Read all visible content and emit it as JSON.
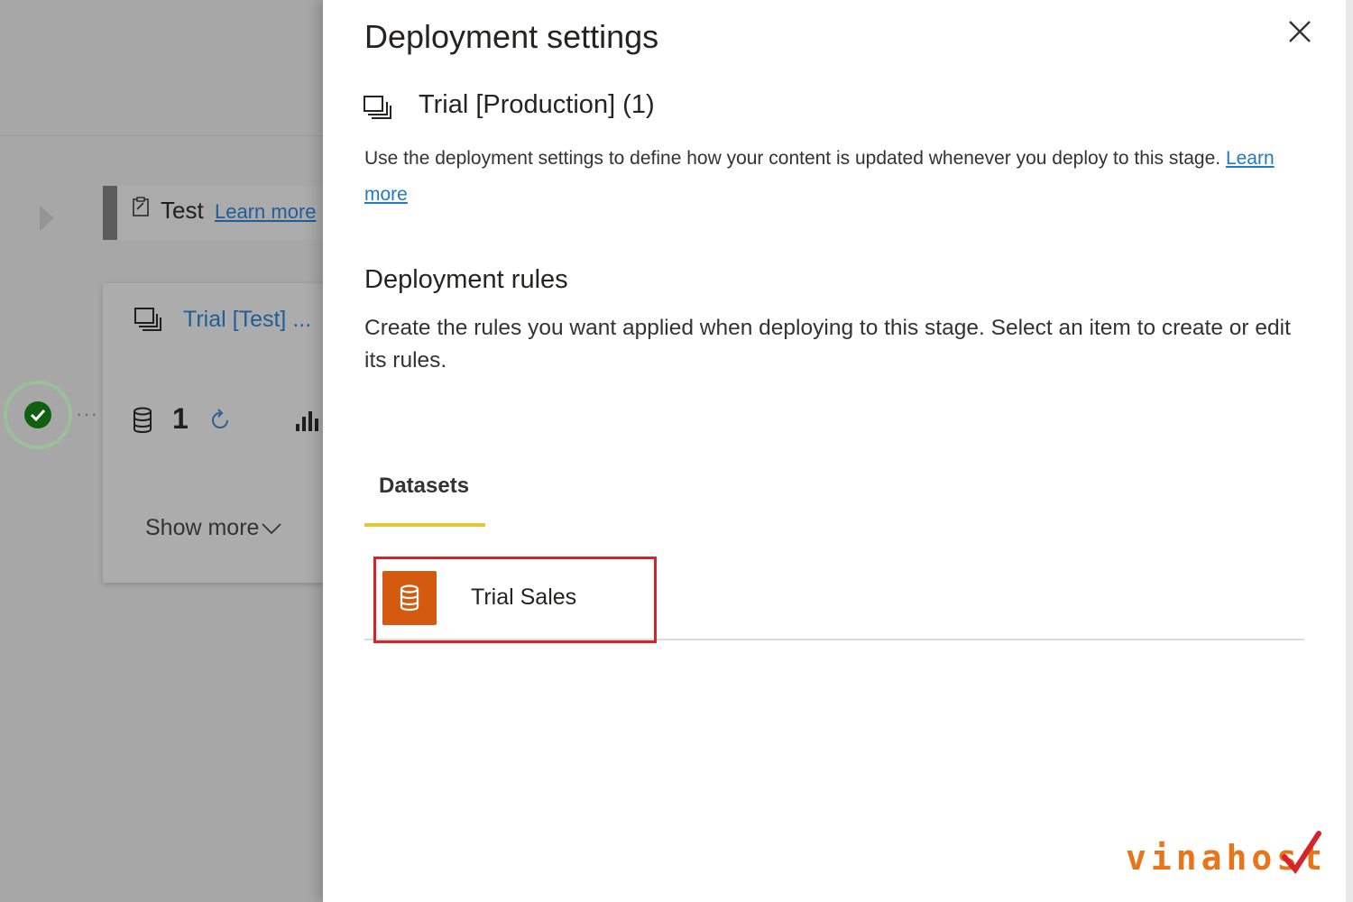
{
  "background": {
    "stage": {
      "name": "Test",
      "link": "Learn more"
    },
    "workspace_card": {
      "name": "Trial [Test] ...",
      "dataset_count": "1",
      "show_more": "Show more"
    },
    "status": "success"
  },
  "panel": {
    "title": "Deployment settings",
    "workspace": "Trial [Production] (1)",
    "description": "Use the deployment settings to define how your content is updated whenever you deploy to this stage.",
    "description_link": "Learn more",
    "rules_title": "Deployment rules",
    "rules_description": "Create the rules you want applied when deploying to this stage. Select an item to create or edit its rules.",
    "tabs": [
      {
        "label": "Datasets",
        "active": true
      }
    ],
    "datasets": [
      {
        "name": "Trial Sales",
        "icon": "dataset-icon",
        "highlighted": true
      }
    ]
  },
  "colors": {
    "accent_tab": "#e8c53a",
    "dataset_tile": "#d35a0e",
    "highlight_box": "#d8232a",
    "link": "#1f7bc4"
  },
  "watermark": {
    "text": "vinahost"
  }
}
